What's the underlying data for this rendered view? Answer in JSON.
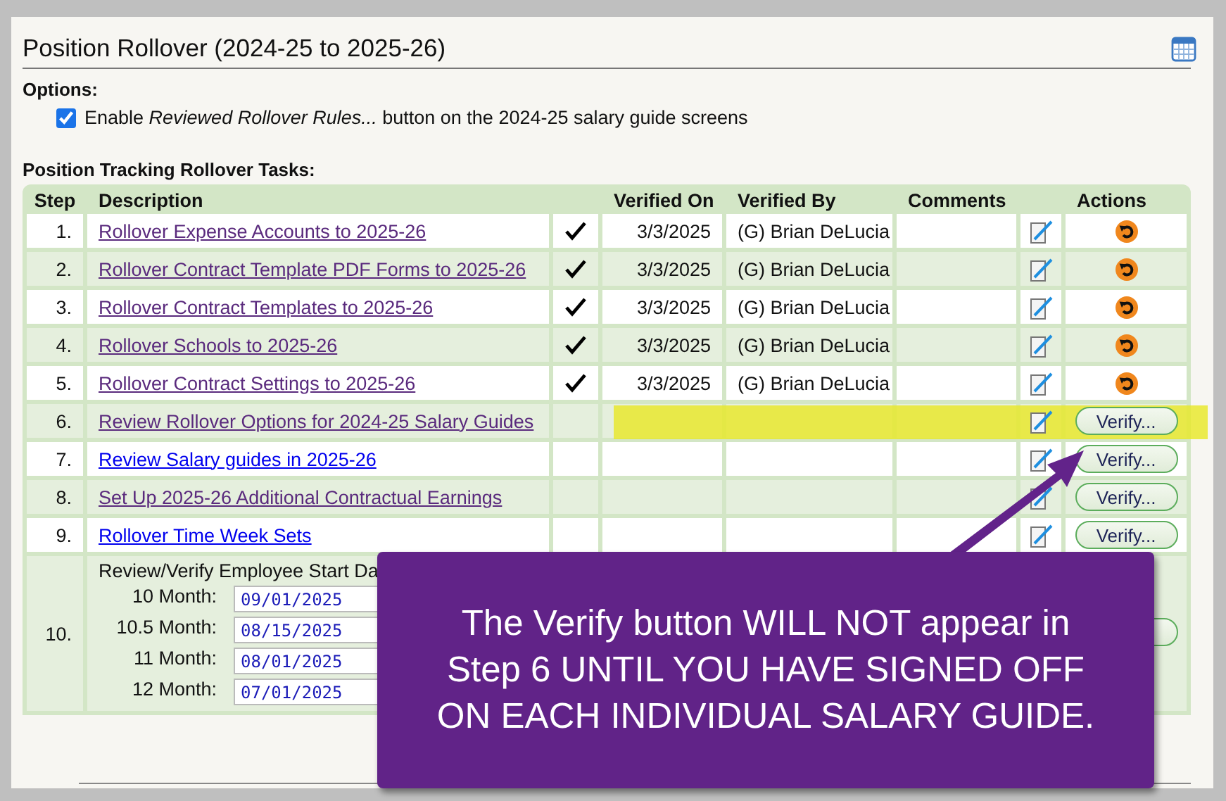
{
  "panel": {
    "title": "Position Rollover (2024-25 to 2025-26)"
  },
  "options": {
    "heading": "Options:",
    "items": [
      {
        "checked": true,
        "text": "Enable *Reviewed Rollover Rules...* button on the 2024-25 salary guide screens"
      }
    ]
  },
  "tasks": {
    "heading": "Position Tracking Rollover Tasks:",
    "columns": [
      "Step",
      "Description",
      "Verified On",
      "Verified By",
      "Comments",
      "Actions"
    ],
    "rows": [
      {
        "kind": "task",
        "step": "1.",
        "description": "Rollover Expense Accounts to 2025-26",
        "visited": true,
        "verified": true,
        "verified_on": "3/3/2025",
        "verified_by": "(G) Brian DeLucia",
        "action": {
          "kind": "undo"
        },
        "highlighted": false
      },
      {
        "kind": "task",
        "step": "2.",
        "description": "Rollover Contract Template PDF Forms to 2025-26",
        "visited": true,
        "verified": true,
        "verified_on": "3/3/2025",
        "verified_by": "(G) Brian DeLucia",
        "action": {
          "kind": "undo"
        },
        "highlighted": false
      },
      {
        "kind": "task",
        "step": "3.",
        "description": "Rollover Contract Templates to 2025-26",
        "visited": true,
        "verified": true,
        "verified_on": "3/3/2025",
        "verified_by": "(G) Brian DeLucia",
        "action": {
          "kind": "undo"
        },
        "highlighted": false
      },
      {
        "kind": "task",
        "step": "4.",
        "description": "Rollover Schools to 2025-26",
        "visited": true,
        "verified": true,
        "verified_on": "3/3/2025",
        "verified_by": "(G) Brian DeLucia",
        "action": {
          "kind": "undo"
        },
        "highlighted": false
      },
      {
        "kind": "task",
        "step": "5.",
        "description": "Rollover Contract Settings to 2025-26",
        "visited": true,
        "verified": true,
        "verified_on": "3/3/2025",
        "verified_by": "(G) Brian DeLucia",
        "action": {
          "kind": "undo"
        },
        "highlighted": false
      },
      {
        "kind": "task",
        "step": "6.",
        "description": "Review Rollover Options for 2024-25 Salary Guides",
        "visited": true,
        "verified": false,
        "action": {
          "kind": "verify",
          "label": "Verify..."
        },
        "highlighted": true
      },
      {
        "kind": "task",
        "step": "7.",
        "description": "Review Salary guides in 2025-26",
        "visited": false,
        "verified": false,
        "action": {
          "kind": "verify",
          "label": "Verify..."
        },
        "highlighted": false
      },
      {
        "kind": "task",
        "step": "8.",
        "description": "Set Up 2025-26 Additional Contractual Earnings",
        "visited": true,
        "verified": false,
        "action": {
          "kind": "verify",
          "label": "Verify..."
        },
        "highlighted": false
      },
      {
        "kind": "task",
        "step": "9.",
        "description": "Rollover Time Week Sets",
        "visited": false,
        "verified": false,
        "action": {
          "kind": "verify",
          "label": "Verify..."
        },
        "highlighted": false
      },
      {
        "kind": "dates",
        "step": "10.",
        "description": "Review/Verify Employee Start Da",
        "dates": [
          {
            "label": "10 Month:",
            "value": "09/01/2025"
          },
          {
            "label": "10.5 Month:",
            "value": "08/15/2025"
          },
          {
            "label": "11 Month:",
            "value": "08/01/2025"
          },
          {
            "label": "12 Month:",
            "value": "07/01/2025"
          }
        ],
        "action": {
          "kind": "verify"
        }
      }
    ]
  },
  "callout": {
    "text": "The Verify button WILL NOT appear in Step 6 UNTIL YOU HAVE SIGNED OFF ON EACH INDIVIDUAL SALARY GUIDE."
  }
}
